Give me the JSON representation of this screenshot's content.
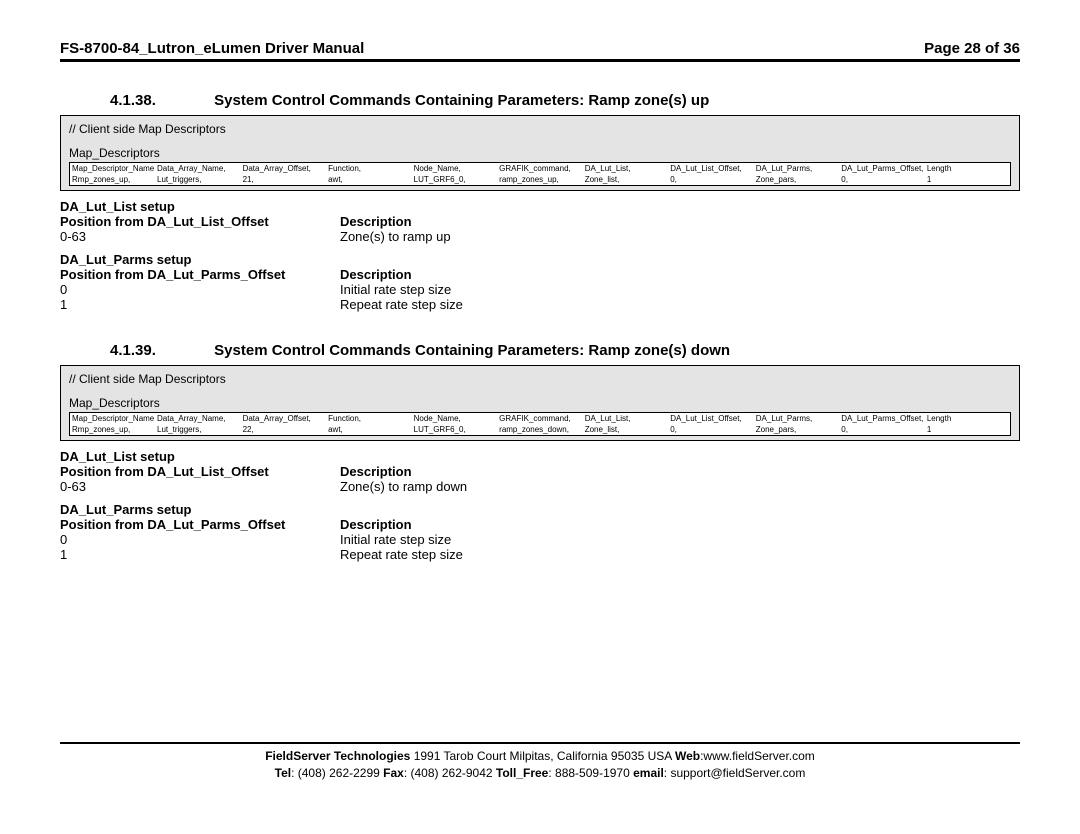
{
  "header": {
    "title": "FS-8700-84_Lutron_eLumen Driver Manual",
    "page": "Page 28 of 36"
  },
  "sec1": {
    "num": "4.1.38.",
    "title": "System Control Commands Containing Parameters: Ramp zone(s) up",
    "box_comment": "//    Client side Map Descriptors",
    "box_subhead": "Map_Descriptors",
    "md_headers": [
      "Map_Descriptor_Name,",
      "Data_Array_Name,",
      "Data_Array_Offset,",
      "Function,",
      "Node_Name,",
      "GRAFIK_command,",
      "DA_Lut_List,",
      "DA_Lut_List_Offset,",
      "DA_Lut_Parms,",
      "DA_Lut_Parms_Offset,",
      "Length"
    ],
    "md_row": [
      "Rmp_zones_up,",
      "Lut_triggers,",
      "21,",
      "awt,",
      "LUT_GRF6_0,",
      "ramp_zones_up,",
      "Zone_list,",
      "0,",
      "Zone_pars,",
      "0,",
      "1"
    ],
    "list_setup_title": "DA_Lut_List setup",
    "list_pos_label": "Position from DA_Lut_List_Offset",
    "desc_label": "Description",
    "list_rows": [
      {
        "pos": "0-63",
        "desc": "Zone(s) to ramp up"
      }
    ],
    "parms_setup_title": "DA_Lut_Parms setup",
    "parms_pos_label": "Position from DA_Lut_Parms_Offset",
    "parms_rows": [
      {
        "pos": "0",
        "desc": "Initial rate step size"
      },
      {
        "pos": "1",
        "desc": "Repeat rate step size"
      }
    ]
  },
  "sec2": {
    "num": "4.1.39.",
    "title": "System Control Commands Containing Parameters: Ramp zone(s) down",
    "box_comment": "//    Client side Map Descriptors",
    "box_subhead": "Map_Descriptors",
    "md_headers": [
      "Map_Descriptor_Name,",
      "Data_Array_Name,",
      "Data_Array_Offset,",
      "Function,",
      "Node_Name,",
      "GRAFIK_command,",
      "DA_Lut_List,",
      "DA_Lut_List_Offset,",
      "DA_Lut_Parms,",
      "DA_Lut_Parms_Offset,",
      "Length"
    ],
    "md_row": [
      "Rmp_zones_up,",
      "Lut_triggers,",
      "22,",
      "awt,",
      "LUT_GRF6_0,",
      "ramp_zones_down,",
      "Zone_list,",
      "0,",
      "Zone_pars,",
      "0,",
      "1"
    ],
    "list_setup_title": "DA_Lut_List setup",
    "list_pos_label": "Position from DA_Lut_List_Offset",
    "desc_label": "Description",
    "list_rows": [
      {
        "pos": "0-63",
        "desc": "Zone(s) to ramp down"
      }
    ],
    "parms_setup_title": "DA_Lut_Parms setup",
    "parms_pos_label": "Position from DA_Lut_Parms_Offset",
    "parms_rows": [
      {
        "pos": "0",
        "desc": "Initial rate step size"
      },
      {
        "pos": "1",
        "desc": "Repeat rate step size"
      }
    ]
  },
  "footer": {
    "l1a": "FieldServer Technologies",
    "l1b": " 1991 Tarob Court Milpitas, California 95035 USA  ",
    "l1c": "Web",
    "l1d": ":www.fieldServer.com",
    "l2a": "Tel",
    "l2b": ": (408) 262-2299  ",
    "l2c": "Fax",
    "l2d": ": (408) 262-9042  ",
    "l2e": "Toll_Free",
    "l2f": ": 888-509-1970   ",
    "l2g": "email",
    "l2h": ": support@fieldServer.com"
  }
}
